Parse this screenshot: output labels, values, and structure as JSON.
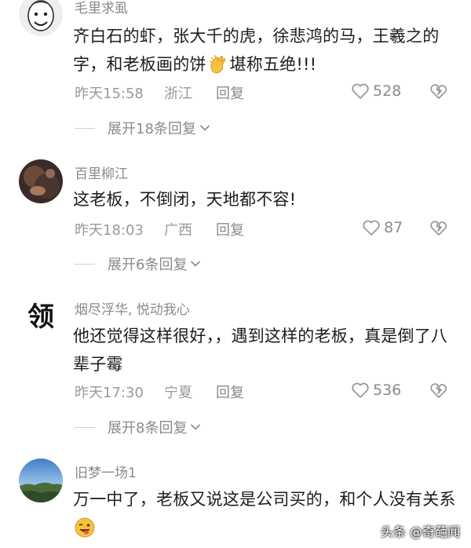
{
  "comments": [
    {
      "username": "毛里求虱",
      "text_before_emoji": "齐白石的虾，张大千的虎，徐悲鸿的马，王羲之的字，和老板画的饼",
      "emoji": "clapping-hands",
      "text_after_emoji": "堪称五绝!!!",
      "time": "昨天15:58",
      "location": "浙江",
      "reply_label": "回复",
      "likes": "528",
      "expand_label": "展开18条回复"
    },
    {
      "username": "百里柳江",
      "text": "这老板，不倒闭，天地都不容!",
      "time": "昨天18:03",
      "location": "广西",
      "reply_label": "回复",
      "likes": "87",
      "expand_label": "展开6条回复"
    },
    {
      "username": "烟尽浮华, 悦动我心",
      "text": "他还觉得这样很好，，遇到这样的老板，真是倒了八辈子霉",
      "time": "昨天17:30",
      "location": "宁夏",
      "reply_label": "回复",
      "likes": "536",
      "expand_label": "展开8条回复"
    },
    {
      "username": "旧梦一场1",
      "text_before_emoji": "万一中了，老板又说这是公司买的，和个人没有关系",
      "emoji": "winking-tongue-face",
      "text_after_emoji": ""
    }
  ],
  "avatars": {
    "third_avatar_char": "领"
  },
  "watermark": "头条 @奇葩闻",
  "colors": {
    "meta_gray": "#9a9a9a",
    "text": "#1c1c1c",
    "icon_gray": "#9a9a9a"
  }
}
